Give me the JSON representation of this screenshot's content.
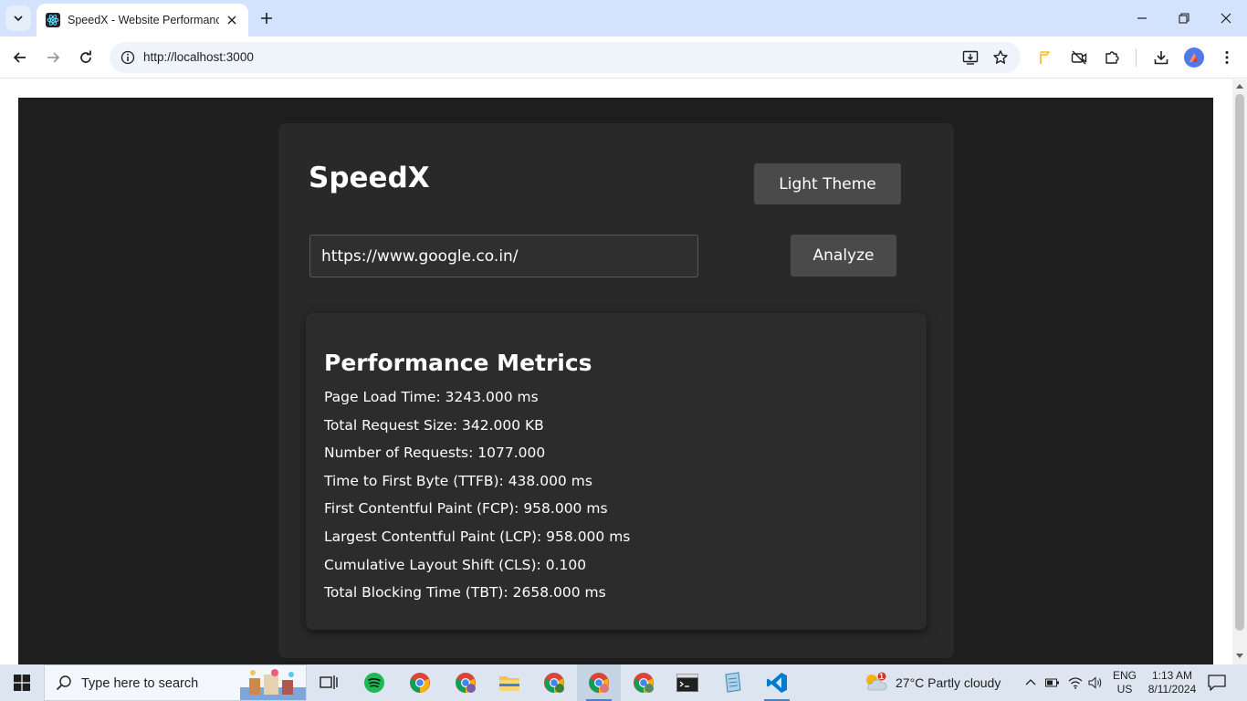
{
  "browser": {
    "tab": {
      "title": "SpeedX - Website Performance",
      "favicon": "react-icon"
    },
    "url": "http://localhost:3000",
    "accent_color": "#d3e3fd"
  },
  "app": {
    "brand": "SpeedX",
    "theme_button": "Light Theme",
    "url_input_value": "https://www.google.co.in/",
    "analyze_button": "Analyze",
    "colors": {
      "background": "#1e1e1e",
      "card": "#292929",
      "button": "#4a4a4a",
      "text": "#ffffff"
    },
    "metrics": {
      "title": "Performance Metrics",
      "items": [
        "Page Load Time: 3243.000 ms",
        "Total Request Size: 342.000 KB",
        "Number of Requests: 1077.000",
        "Time to First Byte (TTFB): 438.000 ms",
        "First Contentful Paint (FCP): 958.000 ms",
        "Largest Contentful Paint (LCP): 958.000 ms",
        "Cumulative Layout Shift (CLS): 0.100",
        "Total Blocking Time (TBT): 2658.000 ms"
      ]
    }
  },
  "taskbar": {
    "search_placeholder": "Type here to search",
    "weather": "27°C  Partly cloudy",
    "weather_badge": "1",
    "language_line1": "ENG",
    "language_line2": "US",
    "time": "1:13 AM",
    "date": "8/11/2024",
    "apps": [
      "task-view",
      "spotify",
      "chrome",
      "chrome-profile-2",
      "file-explorer",
      "chrome-profile-3",
      "chrome-active",
      "chrome-profile-4",
      "terminal",
      "notepad",
      "vscode"
    ]
  }
}
